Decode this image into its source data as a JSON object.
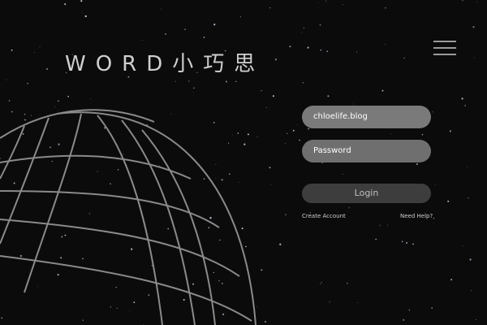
{
  "header": {
    "title": "WORD小巧思",
    "menu_icon": "hamburger-menu-icon"
  },
  "login_form": {
    "username_value": "chloelife.blog",
    "password_placeholder": "Password",
    "login_label": "Login",
    "create_account_label": "Create Account",
    "help_label": "Need Help?"
  },
  "decor": {
    "globe_icon": "wireframe-globe",
    "background": "starfield"
  },
  "colors": {
    "background": "#0b0b0c",
    "field_fill": "#7a7a7a",
    "button_fill": "#3d3d3d",
    "globe_stroke": "#8a8a8a"
  }
}
